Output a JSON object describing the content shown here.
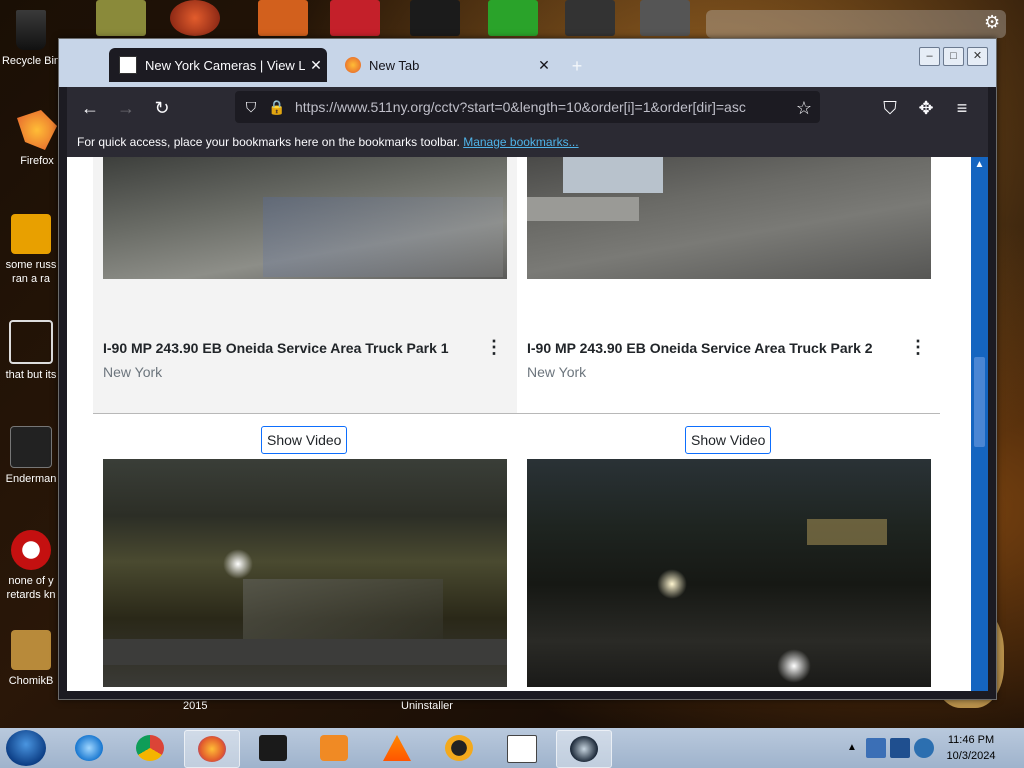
{
  "desktop": {
    "icons": [
      {
        "name": "recycle-bin-icon",
        "label": "Recycle Bin"
      },
      {
        "name": "firefox-desktop-icon",
        "label": "Firefox"
      },
      {
        "name": "russian-video-icon",
        "label": "some russ ran a ra"
      },
      {
        "name": "that-but-its-icon",
        "label": "that but its"
      },
      {
        "name": "enderman-icon",
        "label": "Enderman"
      },
      {
        "name": "none-of-you-icon",
        "label": "none of y retards kn"
      },
      {
        "name": "chomik-icon",
        "label": "ChomikB"
      }
    ],
    "captions": [
      "2015",
      "Uninstaller"
    ]
  },
  "browser": {
    "tabs": [
      {
        "title": "New York Cameras | View Live N",
        "active": true
      },
      {
        "title": "New Tab",
        "active": false
      }
    ],
    "url": "https://www.511ny.org/cctv?start=0&length=10&order[i]=1&order[dir]=asc",
    "bookmarks_msg": "For quick access, place your bookmarks here on the bookmarks toolbar.",
    "bookmarks_link": "Manage bookmarks..."
  },
  "page": {
    "cameras": [
      {
        "title": "I-90 MP 243.90 EB Oneida Service Area Truck Park 1",
        "location": "New York"
      },
      {
        "title": "I-90 MP 243.90 EB Oneida Service Area Truck Park 2",
        "location": "New York"
      }
    ],
    "show_video_label": "Show Video"
  },
  "taskbar": {
    "apps": [
      "internet-explorer",
      "chrome",
      "firefox",
      "media-box",
      "video-player",
      "vlc",
      "aimp",
      "calendar-321",
      "steam"
    ],
    "time": "11:46 PM",
    "date": "10/3/2024"
  },
  "colors": {
    "titlebar": "#c7d5e8",
    "toolbar": "#2b2a33",
    "link": "#4fb3e8",
    "scroll": "#1565c0",
    "taskbar": "#a9bcd4"
  }
}
